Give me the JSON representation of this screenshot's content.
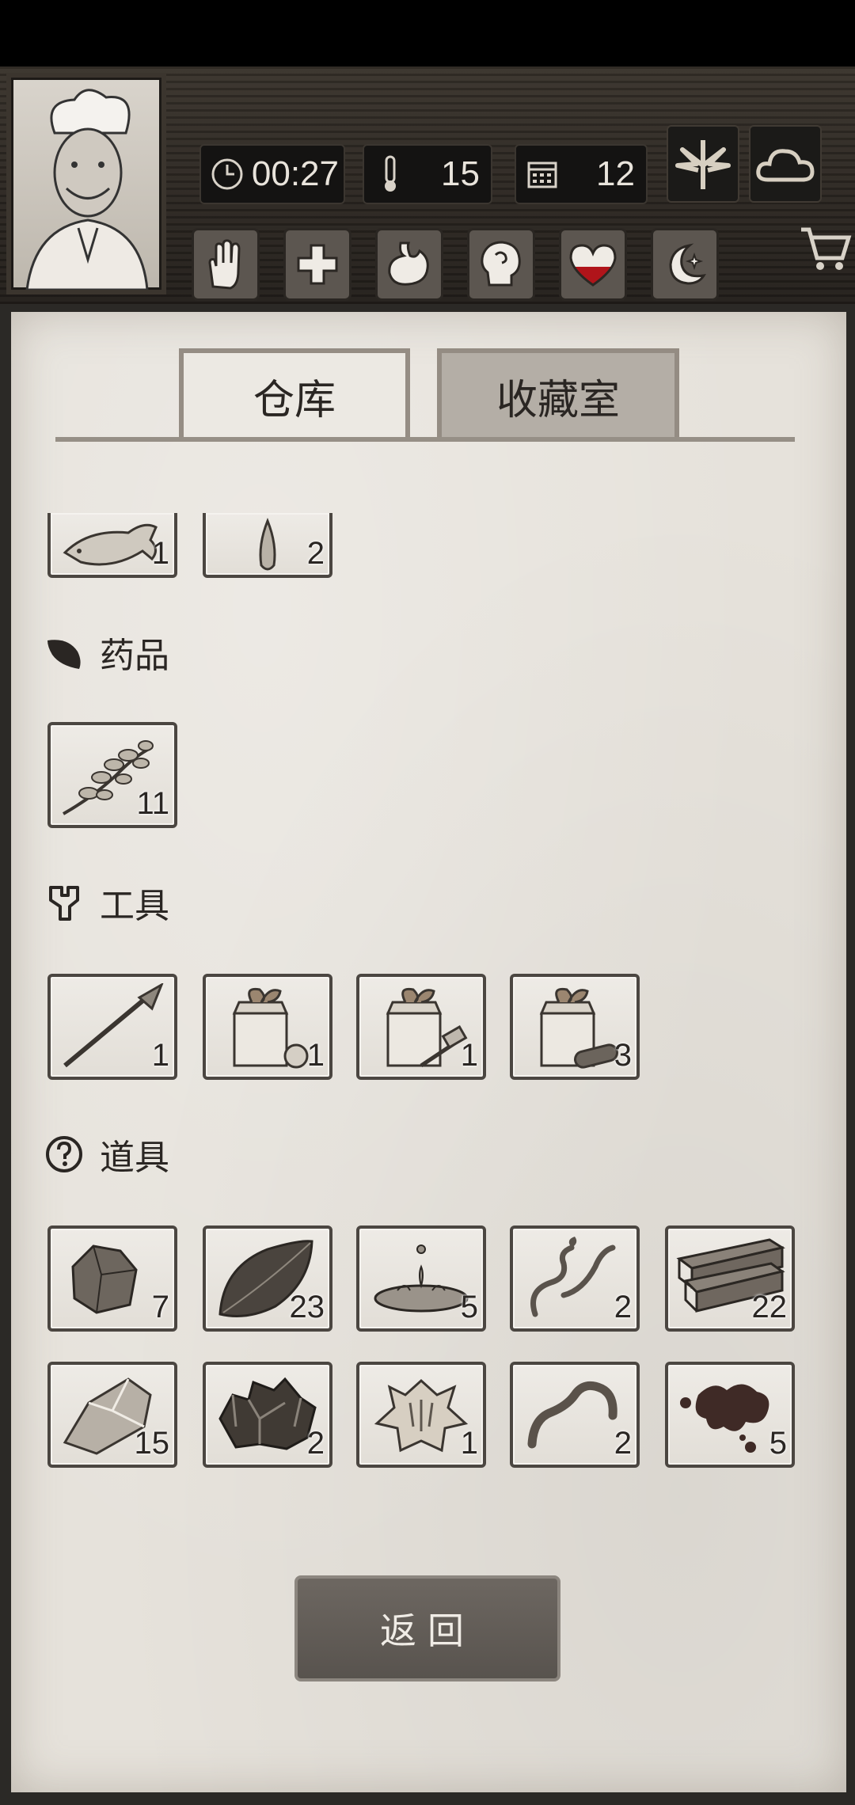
{
  "header": {
    "time": "00:27",
    "temperature": "15",
    "day": "12",
    "weather_icons": [
      "leaf-icon",
      "cloud-icon"
    ],
    "status_icons": [
      "hand-icon",
      "health-cross-icon",
      "stomach-icon",
      "head-icon",
      "heart-icon",
      "moon-icon"
    ],
    "heart_level": 0.45
  },
  "tabs": [
    {
      "label": "仓库",
      "selected": true
    },
    {
      "label": "收藏室",
      "selected": false
    }
  ],
  "food_partial": [
    {
      "icon": "fish-icon",
      "count": "1"
    },
    {
      "icon": "seed-icon",
      "count": "2"
    }
  ],
  "sections": {
    "medicine": {
      "title": "药品",
      "items": [
        {
          "icon": "herb-icon",
          "count": "11"
        }
      ]
    },
    "tools": {
      "title": "工具",
      "items": [
        {
          "icon": "spear-icon",
          "count": "1"
        },
        {
          "icon": "gift-box-icon",
          "count": "1"
        },
        {
          "icon": "gift-box-icon",
          "count": "1"
        },
        {
          "icon": "gift-box-icon",
          "count": "3"
        }
      ]
    },
    "props": {
      "title": "道具",
      "items": [
        {
          "icon": "stone-icon",
          "count": "7"
        },
        {
          "icon": "leaf-icon",
          "count": "23"
        },
        {
          "icon": "water-icon",
          "count": "5"
        },
        {
          "icon": "vine-icon",
          "count": "2"
        },
        {
          "icon": "wood-planks-icon",
          "count": "22"
        },
        {
          "icon": "flint-icon",
          "count": "15"
        },
        {
          "icon": "ore-icon",
          "count": "2"
        },
        {
          "icon": "animal-hide-icon",
          "count": "1"
        },
        {
          "icon": "worm-icon",
          "count": "2"
        },
        {
          "icon": "blood-icon",
          "count": "5"
        }
      ]
    }
  },
  "return_label": "返回",
  "colors": {
    "paper": "#e6e2db",
    "wood": "#2f2a25",
    "button": "#625c56",
    "heart_red": "#b0141a"
  }
}
